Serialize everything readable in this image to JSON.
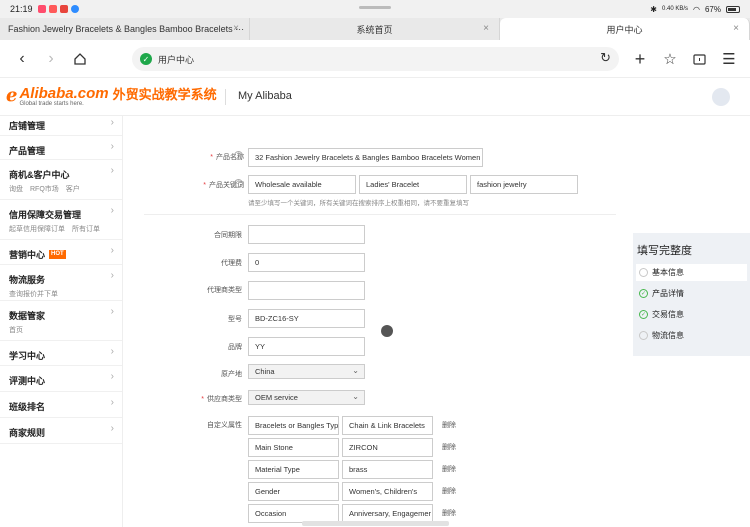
{
  "status": {
    "time": "21:19",
    "network": "0.40 KB/s",
    "battery": "67%"
  },
  "tabs": [
    {
      "label": "Fashion Jewelry Bracelets & Bangles Bamboo Bracelets ···",
      "close": "×"
    },
    {
      "label": "系统首页",
      "close": "×"
    },
    {
      "label": "用户中心",
      "close": "×"
    }
  ],
  "toolbar": {
    "url": "用户中心"
  },
  "header": {
    "logo_name": "Alibaba.com",
    "logo_slogan": "Global trade starts here.",
    "logo_cn": "外贸实战教学系统",
    "my_alibaba": "My Alibaba"
  },
  "sidebar": {
    "items": [
      {
        "title": "店铺管理"
      },
      {
        "title": "产品管理"
      },
      {
        "title": "商机&客户中心",
        "subs": [
          "询盘",
          "RFQ市场",
          "客户"
        ]
      },
      {
        "title": "信用保障交易管理",
        "subs": [
          "起草信用保障订单",
          "所有订单"
        ]
      },
      {
        "title": "营销中心",
        "badge": "HOT"
      },
      {
        "title": "物流服务",
        "subs": [
          "查询报价并下单"
        ]
      },
      {
        "title": "数据管家",
        "subs": [
          "首页"
        ]
      },
      {
        "title": "学习中心"
      },
      {
        "title": "评测中心"
      },
      {
        "title": "班级排名"
      },
      {
        "title": "商家规则"
      }
    ]
  },
  "form": {
    "product_name_label": "产品名称",
    "product_name_value": "32 Fashion Jewelry Bracelets & Bangles Bamboo Bracelets Women W",
    "keywords_label": "产品关键词",
    "keywords": [
      "Wholesale available",
      "Ladies' Bracelet",
      "fashion jewelry"
    ],
    "keywords_hint": "请至少填写一个关键词，所有关键词在搜索排序上权重相同，请不要重复填写",
    "contract_label": "合同期限",
    "contract_value": "",
    "agency_fee_label": "代理费",
    "agency_fee_value": "0",
    "agent_type_label": "代理商类型",
    "agent_type_value": "",
    "model_label": "型号",
    "model_value": "BD-ZC16-SY",
    "brand_label": "品牌",
    "brand_value": "YY",
    "origin_label": "原产地",
    "origin_value": "China",
    "supplier_type_label": "供应商类型",
    "supplier_type_value": "OEM service",
    "custom_attr_label": "自定义属性",
    "delete_label": "删除",
    "custom_attrs": [
      {
        "name": "Bracelets or Bangles Typ",
        "value": "Chain & Link Bracelets"
      },
      {
        "name": "Main Stone",
        "value": "ZIRCON"
      },
      {
        "name": "Material Type",
        "value": "brass"
      },
      {
        "name": "Gender",
        "value": "Women's, Children's"
      },
      {
        "name": "Occasion",
        "value": "Anniversary, Engagemer"
      }
    ]
  },
  "completeness": {
    "title": "填写完整度",
    "items": [
      {
        "label": "基本信息",
        "done": false,
        "active": true
      },
      {
        "label": "产品详情",
        "done": true,
        "active": false
      },
      {
        "label": "交易信息",
        "done": true,
        "active": false
      },
      {
        "label": "物流信息",
        "done": false,
        "active": false
      }
    ]
  }
}
